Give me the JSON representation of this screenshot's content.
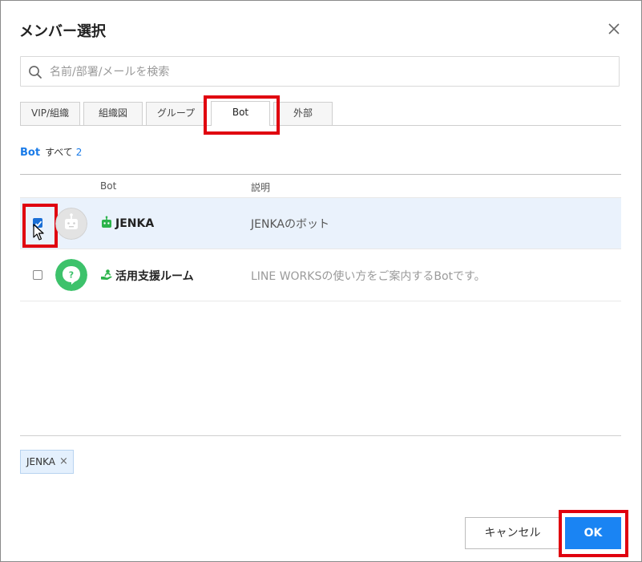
{
  "dialog": {
    "title": "メンバー選択",
    "close_icon": "close-icon"
  },
  "search": {
    "placeholder": "名前/部署/メールを検索",
    "value": "",
    "icon": "search-icon"
  },
  "tabs": [
    {
      "label": "VIP/組織",
      "active": false
    },
    {
      "label": "組織図",
      "active": false
    },
    {
      "label": "グループ",
      "active": false
    },
    {
      "label": "Bot",
      "active": true
    },
    {
      "label": "外部",
      "active": false
    }
  ],
  "list_header": {
    "category": "Bot",
    "all_label": "すべて",
    "count": "2"
  },
  "table": {
    "columns": [
      "Bot",
      "説明"
    ],
    "rows": [
      {
        "name": "JENKA",
        "description": "JENKAのボット",
        "checked": true,
        "avatar_icon": "robot-avatar-icon",
        "badge_icon": "bot-badge-icon"
      },
      {
        "name": "活用支援ルーム",
        "description": "LINE WORKSの使い方をご案内するBotです。",
        "checked": false,
        "avatar_icon": "help-bubble-avatar-icon",
        "badge_icon": "helping-hand-icon"
      }
    ]
  },
  "selected_chips": [
    {
      "label": "JENKA",
      "remove_icon": "×"
    }
  ],
  "buttons": {
    "cancel": "キャンセル",
    "ok": "OK"
  },
  "colors": {
    "accent": "#1a84f3",
    "highlight": "#e0000f",
    "selected_row": "#eaf2fc",
    "bot_green": "#2bb34a"
  }
}
